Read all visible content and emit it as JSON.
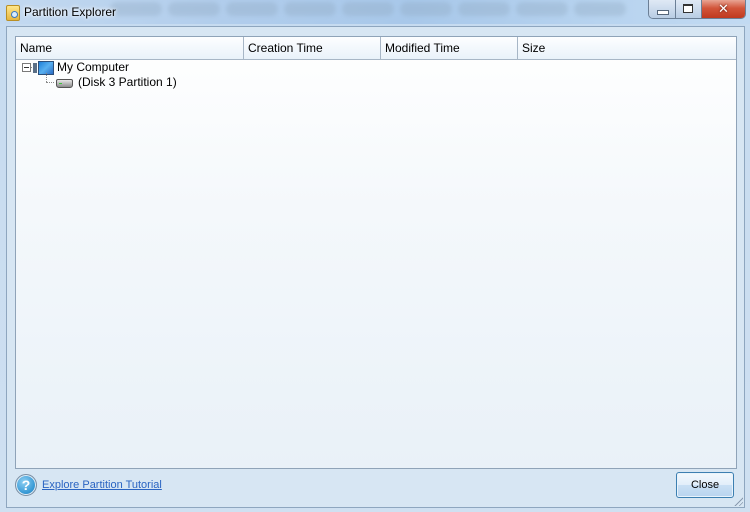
{
  "window": {
    "title": "Partition Explorer",
    "caption_buttons": {
      "minimize_icon": "minimize-icon",
      "maximize_icon": "maximize-icon",
      "close_glyph": "✕"
    }
  },
  "listview": {
    "columns": [
      {
        "label": "Name"
      },
      {
        "label": "Creation Time"
      },
      {
        "label": "Modified Time"
      },
      {
        "label": "Size"
      }
    ],
    "tree": [
      {
        "label": "My Computer",
        "icon": "computer-icon",
        "expanded": true
      },
      {
        "label": "(Disk 3 Partition 1)",
        "icon": "hard-drive-icon"
      }
    ]
  },
  "footer": {
    "help_glyph": "?",
    "tutorial_link": "Explore Partition Tutorial",
    "close_button": "Close"
  }
}
